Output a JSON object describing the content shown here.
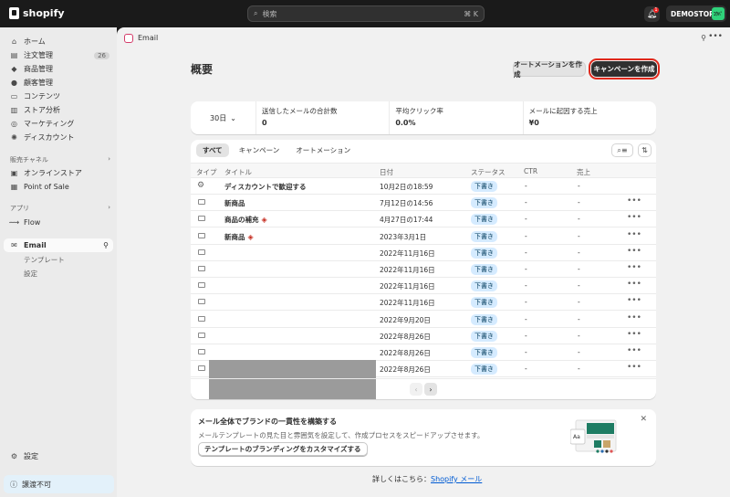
{
  "topbar": {
    "logo_text": "shopify",
    "search_placeholder": "検索",
    "search_shortcut": "⌘ K",
    "notification_count": "1",
    "store_name": "DEMOSTORE",
    "store_avatar": "ｺｳﾊﾞ"
  },
  "sidebar": {
    "items": [
      {
        "label": "ホーム",
        "icon": "home-icon"
      },
      {
        "label": "注文管理",
        "icon": "orders-icon",
        "badge": "26"
      },
      {
        "label": "商品管理",
        "icon": "tag-icon"
      },
      {
        "label": "顧客管理",
        "icon": "person-icon"
      },
      {
        "label": "コンテンツ",
        "icon": "content-icon"
      },
      {
        "label": "ストア分析",
        "icon": "chart-icon"
      },
      {
        "label": "マーケティング",
        "icon": "target-icon"
      },
      {
        "label": "ディスカウント",
        "icon": "discount-icon"
      }
    ],
    "sales_channels_header": "販売チャネル",
    "channels": [
      {
        "label": "オンラインストア",
        "icon": "store-icon"
      },
      {
        "label": "Point of Sale",
        "icon": "pos-icon"
      }
    ],
    "apps_header": "アプリ",
    "apps": [
      {
        "label": "Flow",
        "icon": "flow-icon"
      }
    ],
    "email_app": {
      "label": "Email",
      "subitems": [
        "テンプレート",
        "設定"
      ]
    },
    "settings_label": "設定",
    "transfer_label": "譲渡不可"
  },
  "app_header": {
    "title": "Email"
  },
  "page": {
    "title": "概要",
    "automation_button": "オートメーションを作成",
    "campaign_button": "キャンペーンを作成"
  },
  "stats": {
    "period": "30日",
    "cells": [
      {
        "label": "送信したメールの合計数",
        "value": "0"
      },
      {
        "label": "平均クリック率",
        "value": "0.0%"
      },
      {
        "label": "メールに起因する売上",
        "value": "¥0"
      }
    ]
  },
  "table": {
    "tabs": [
      "すべて",
      "キャンペーン",
      "オートメーション"
    ],
    "headers": [
      "タイプ",
      "タイトル",
      "日付",
      "ステータス",
      "CTR",
      "売上"
    ],
    "rows": [
      {
        "type": "automation",
        "title": "ディスカウントで歓迎する",
        "date": "10月2日の18:59",
        "status": "下書き",
        "ctr": "-",
        "sales": "-",
        "warn": false,
        "more": false
      },
      {
        "type": "email",
        "title": "新商品",
        "date": "7月12日の14:56",
        "status": "下書き",
        "ctr": "-",
        "sales": "-",
        "warn": false,
        "more": true
      },
      {
        "type": "email",
        "title": "商品の補充",
        "date": "4月27日の17:44",
        "status": "下書き",
        "ctr": "-",
        "sales": "-",
        "warn": true,
        "more": true
      },
      {
        "type": "email",
        "title": "新商品",
        "date": "2023年3月1日",
        "status": "下書き",
        "ctr": "-",
        "sales": "-",
        "warn": true,
        "more": true
      },
      {
        "type": "email",
        "title": "",
        "date": "2022年11月16日",
        "status": "下書き",
        "ctr": "-",
        "sales": "-",
        "warn": false,
        "more": true
      },
      {
        "type": "email",
        "title": "",
        "date": "2022年11月16日",
        "status": "下書き",
        "ctr": "-",
        "sales": "-",
        "warn": false,
        "more": true
      },
      {
        "type": "email",
        "title": "",
        "date": "2022年11月16日",
        "status": "下書き",
        "ctr": "-",
        "sales": "-",
        "warn": false,
        "more": true
      },
      {
        "type": "email",
        "title": "",
        "date": "2022年11月16日",
        "status": "下書き",
        "ctr": "-",
        "sales": "-",
        "warn": false,
        "more": true
      },
      {
        "type": "email",
        "title": "",
        "date": "2022年9月20日",
        "status": "下書き",
        "ctr": "-",
        "sales": "-",
        "warn": false,
        "more": true
      },
      {
        "type": "email",
        "title": "",
        "date": "2022年8月26日",
        "status": "下書き",
        "ctr": "-",
        "sales": "-",
        "warn": false,
        "more": true
      },
      {
        "type": "email",
        "title": "",
        "date": "2022年8月26日",
        "status": "下書き",
        "ctr": "-",
        "sales": "-",
        "warn": false,
        "more": true
      },
      {
        "type": "email",
        "title": "",
        "date": "2022年8月26日",
        "status": "下書き",
        "ctr": "-",
        "sales": "-",
        "warn": false,
        "more": true
      }
    ]
  },
  "promo": {
    "heading": "メール全体でブランドの一貫性を構築する",
    "description": "メールテンプレートの見た目と雰囲気を設定して、作成プロセスをスピードアップさせます。",
    "button": "テンプレートのブランディングをカスタマイズする",
    "illustration_text": "Aa"
  },
  "footer": {
    "text": "詳しくはこちら：",
    "link": "Shopify メール"
  },
  "colors": {
    "accent_red": "#e0281b",
    "status_blue": "#d5ebff",
    "link_blue": "#005bd3"
  }
}
